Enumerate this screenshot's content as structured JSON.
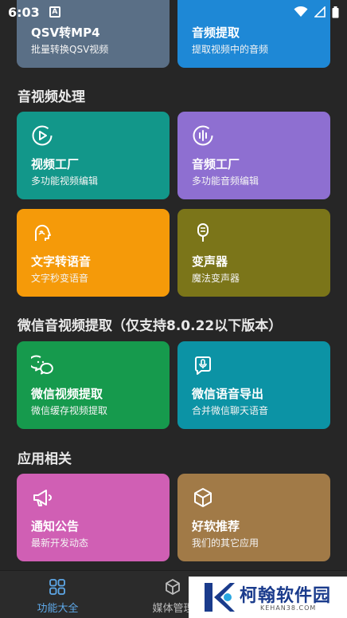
{
  "status": {
    "time": "6:03",
    "notif_letter": "A"
  },
  "top_cards": [
    {
      "title": "QSV转MP4",
      "sub": "批量转换QSV视频",
      "color": "#5a6f86"
    },
    {
      "title": "音频提取",
      "sub": "提取视频中的音频",
      "color": "#1e88d6"
    }
  ],
  "sections": [
    {
      "title": "音视频处理"
    },
    {
      "title": "微信音视频提取（仅支持8.0.22以下版本）"
    },
    {
      "title": "应用相关"
    }
  ],
  "cards": [
    {
      "title": "视频工厂",
      "sub": "多功能视频编辑",
      "icon": "video-play-icon",
      "color": "#12978a"
    },
    {
      "title": "音频工厂",
      "sub": "多功能音频编辑",
      "icon": "audio-wave-icon",
      "color": "#8e6fd1"
    },
    {
      "title": "文字转语音",
      "sub": "文字秒变语音",
      "icon": "speaking-head-icon",
      "color": "#f59a09"
    },
    {
      "title": "变声器",
      "sub": "魔法变声器",
      "icon": "microphone-icon",
      "color": "#7b7519"
    },
    {
      "title": "微信视频提取",
      "sub": "微信缓存视频提取",
      "icon": "wechat-icon",
      "color": "#169a4d"
    },
    {
      "title": "微信语音导出",
      "sub": "合并微信聊天语音",
      "icon": "voice-message-icon",
      "color": "#0c93a5"
    },
    {
      "title": "通知公告",
      "sub": "最新开发动态",
      "icon": "megaphone-icon",
      "color": "#d05fb4"
    },
    {
      "title": "好软推荐",
      "sub": "我们的其它应用",
      "icon": "box-icon",
      "color": "#a17a47"
    }
  ],
  "nav": [
    {
      "label": "功能大全",
      "icon": "grid-icon",
      "active": true
    },
    {
      "label": "媒体管理",
      "icon": "cube-icon",
      "active": false
    }
  ],
  "watermark": {
    "text": "柯翰软件园",
    "sub": "KEHAN38.COM"
  },
  "colors": {
    "nav_active": "#5ea8e8",
    "nav_inactive": "#bdbdbd",
    "background": "#262626"
  }
}
